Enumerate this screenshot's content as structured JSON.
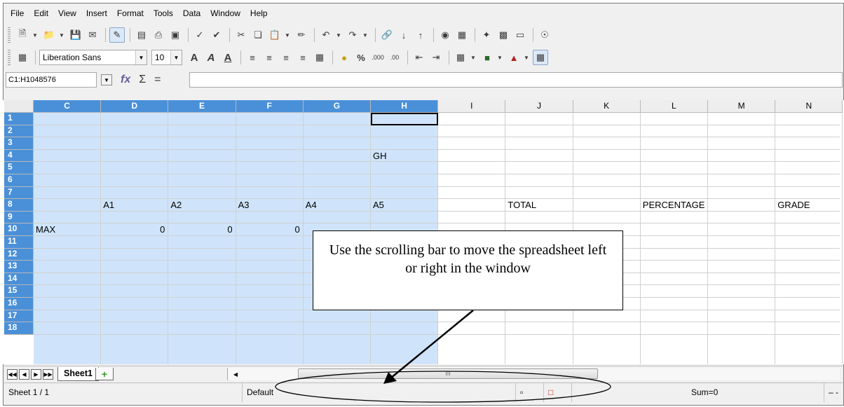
{
  "menu": [
    "File",
    "Edit",
    "View",
    "Insert",
    "Format",
    "Tools",
    "Data",
    "Window",
    "Help"
  ],
  "toolbar2": {
    "font_name": "Liberation Sans",
    "font_size": "10"
  },
  "formula": {
    "name_box": "C1:H1048576",
    "sum_symbol": "Σ",
    "equals_symbol": "="
  },
  "columns": [
    "C",
    "D",
    "E",
    "F",
    "G",
    "H",
    "I",
    "J",
    "K",
    "L",
    "M",
    "N"
  ],
  "rows": [
    "1",
    "2",
    "3",
    "4",
    "5",
    "6",
    "7",
    "8",
    "9",
    "10",
    "11",
    "12",
    "13",
    "14",
    "15",
    "16",
    "17",
    "18"
  ],
  "cells": {
    "H4": "GH",
    "D8": "A1",
    "E8": "A2",
    "F8": "A3",
    "G8": "A4",
    "H8": "A5",
    "J8": "TOTAL",
    "L8": "PERCENTAGE",
    "N8": "GRADE",
    "C10": "MAX",
    "D10": "0",
    "E10": "0",
    "F10": "0"
  },
  "tabs": {
    "sheet_name": "Sheet1"
  },
  "scrollbar": {
    "thumb_marker": "III"
  },
  "status": {
    "sheet": "Sheet 1 / 1",
    "style": "Default",
    "sum": "Sum=0"
  },
  "callout": {
    "text": "Use the scrolling bar to move the spreadsheet left or right in the window"
  },
  "colors": {
    "selection_fill": "#cfe4fb",
    "selected_header": "#4a90d9"
  }
}
